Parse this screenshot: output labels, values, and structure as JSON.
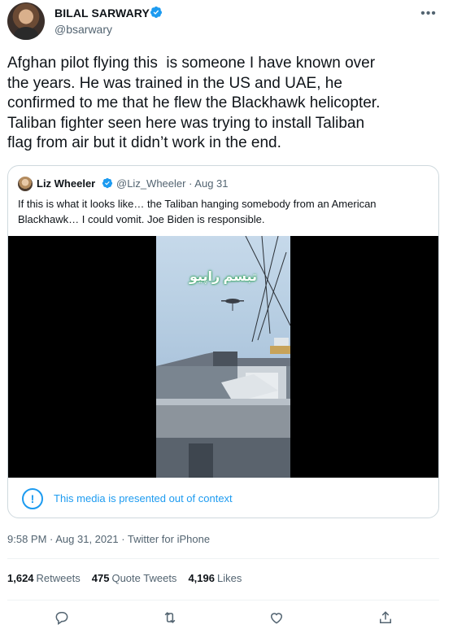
{
  "author": {
    "name": "BILAL SARWARY",
    "handle": "@bsarwary"
  },
  "tweet_text": "Afghan pilot flying this  is someone I have known over\nthe years. He was trained in the US and UAE, he\nconfirmed to me that he flew the Blackhawk helicopter.\nTaliban fighter seen here was trying to install Taliban\nflag from air but it didn’t work in the end.",
  "quoted": {
    "name": "Liz Wheeler",
    "handle_date": "@Liz_Wheeler · Aug 31",
    "text": "If this is what it looks like… the Taliban hanging somebody from an American Blackhawk… I could vomit. Joe Biden is responsible.",
    "video_overlay_text": "تبسم راپیو",
    "context_notice": "This media is presented out of context"
  },
  "meta": "9:58 PM · Aug 31, 2021 · Twitter for iPhone",
  "stats": {
    "retweets": {
      "count": "1,624",
      "label": "Retweets"
    },
    "quotes": {
      "count": "475",
      "label": "Quote Tweets"
    },
    "likes": {
      "count": "4,196",
      "label": "Likes"
    }
  },
  "icons": {
    "more": "more-icon",
    "verified": "verified-badge-icon",
    "info": "info-icon",
    "reply": "reply-icon",
    "retweet": "retweet-icon",
    "like": "like-icon",
    "share": "share-icon"
  },
  "colors": {
    "accent": "#1d9bf0",
    "text": "#0f1419",
    "secondary": "#536471",
    "border": "#cfd9de"
  }
}
